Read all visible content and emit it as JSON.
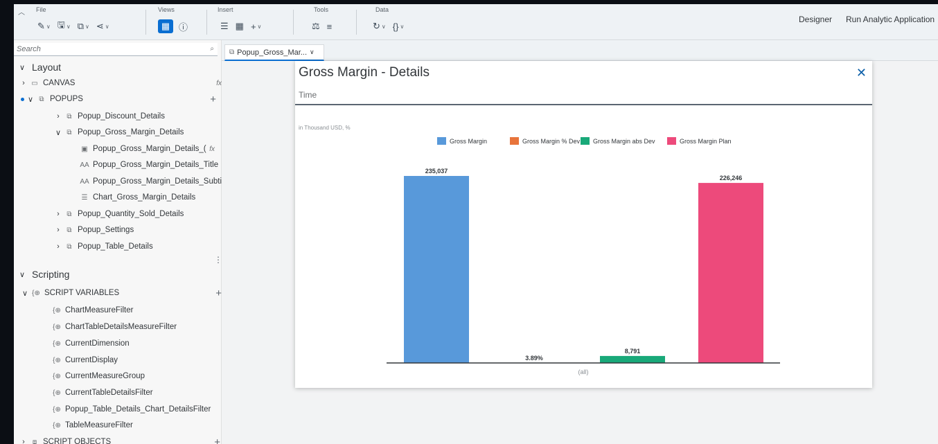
{
  "toolbar": {
    "collapse_icon": "chevron-up-icon",
    "groups": {
      "file": {
        "title": "File"
      },
      "views": {
        "title": "Views"
      },
      "insert": {
        "title": "Insert"
      },
      "tools": {
        "title": "Tools"
      },
      "data": {
        "title": "Data"
      }
    },
    "designer_label": "Designer",
    "run_label": "Run Analytic Application"
  },
  "sidebar": {
    "search_placeholder": "Search",
    "layout_label": "Layout",
    "canvas_label": "CANVAS",
    "popups_label": "POPUPS",
    "popup_items": {
      "discount": "Popup_Discount_Details",
      "gross": "Popup_Gross_Margin_Details",
      "gross_children": {
        "chart_popup": "Popup_Gross_Margin_Details_(",
        "title": "Popup_Gross_Margin_Details_Title",
        "subtitle": "Popup_Gross_Margin_Details_Subtit",
        "chart": "Chart_Gross_Margin_Details"
      },
      "quantity": "Popup_Quantity_Sold_Details",
      "settings": "Popup_Settings",
      "table": "Popup_Table_Details"
    },
    "scripting_label": "Scripting",
    "script_variables_label": "SCRIPT VARIABLES",
    "variables": {
      "v0": "ChartMeasureFilter",
      "v1": "ChartTableDetailsMeasureFilter",
      "v2": "CurrentDimension",
      "v3": "CurrentDisplay",
      "v4": "CurrentMeasureGroup",
      "v5": "CurrentTableDetailsFilter",
      "v6": "Popup_Table_Details_Chart_DetailsFilter",
      "v7": "TableMeasureFilter"
    },
    "script_objects_label": "SCRIPT OBJECTS"
  },
  "tab": {
    "label": "Popup_Gross_Mar..."
  },
  "popup": {
    "title": "Gross Margin - Details",
    "subtitle": "Time",
    "close_icon": "close-icon"
  },
  "chart_data": {
    "type": "bar",
    "unit_note": "in Thousand USD, %",
    "categories": [
      "(all)"
    ],
    "legend_position": "top",
    "series": [
      {
        "name": "Gross Margin",
        "values": [
          235037
        ],
        "label": "235,037",
        "color": "#5899DA"
      },
      {
        "name": "Gross Margin % Dev",
        "values": [
          3.89
        ],
        "label": "3.89%",
        "color": "#E8743B"
      },
      {
        "name": "Gross Margin abs Dev",
        "values": [
          8791
        ],
        "label": "8,791",
        "color": "#19A979"
      },
      {
        "name": "Gross Margin Plan",
        "values": [
          226246
        ],
        "label": "226,246",
        "color": "#ED4A7B"
      }
    ],
    "ylim": [
      0,
      235037
    ],
    "grid": false
  }
}
